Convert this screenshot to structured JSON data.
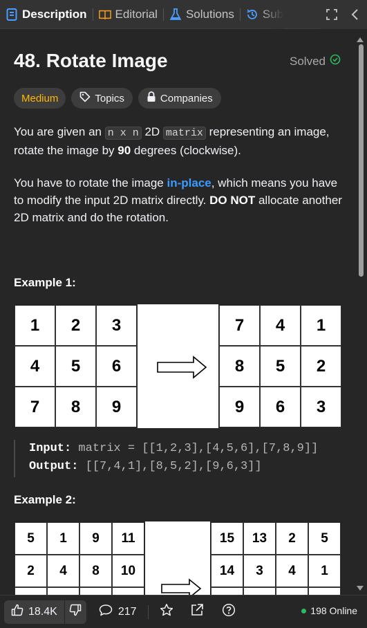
{
  "tabs": [
    {
      "label": "Description",
      "icon": "description-icon",
      "active": true
    },
    {
      "label": "Editorial",
      "icon": "book-icon",
      "active": false
    },
    {
      "label": "Solutions",
      "icon": "flask-icon",
      "active": false
    },
    {
      "label": "Subm",
      "icon": "history-icon",
      "active": false
    }
  ],
  "toolbar_icons": [
    "expand-icon",
    "chevron-left-icon"
  ],
  "problem": {
    "title": "48. Rotate Image",
    "status": "Solved",
    "difficulty": "Medium",
    "topics_label": "Topics",
    "companies_label": "Companies",
    "p1_a": "You are given an ",
    "p1_code1": "n x n",
    "p1_b": " 2D ",
    "p1_code2": "matrix",
    "p1_c": " representing an image, rotate the image by ",
    "p1_bold": "90",
    "p1_d": " degrees (clockwise).",
    "p2_a": "You have to rotate the image ",
    "p2_link": "in-place",
    "p2_b": ", which means you have to modify the input 2D matrix directly. ",
    "p2_bold": "DO NOT",
    "p2_c": " allocate another 2D matrix and do the rotation."
  },
  "example1": {
    "heading": "Example 1:",
    "input_grid": [
      "1",
      "2",
      "3",
      "4",
      "5",
      "6",
      "7",
      "8",
      "9"
    ],
    "output_grid": [
      "7",
      "4",
      "1",
      "8",
      "5",
      "2",
      "9",
      "6",
      "3"
    ],
    "input_label": "Input:",
    "input_value": " matrix = [[1,2,3],[4,5,6],[7,8,9]]",
    "output_label": "Output:",
    "output_value": " [[7,4,1],[8,5,2],[9,6,3]]"
  },
  "example2": {
    "heading": "Example 2:",
    "input_grid": [
      "5",
      "1",
      "9",
      "11",
      "2",
      "4",
      "8",
      "10",
      "",
      "",
      "",
      "",
      ""
    ],
    "output_grid": [
      "15",
      "13",
      "2",
      "5",
      "14",
      "3",
      "4",
      "1",
      "",
      "",
      "",
      ""
    ]
  },
  "bottom": {
    "likes": "18.4K",
    "comments": "217",
    "online": "198 Online"
  },
  "colors": {
    "accent_blue": "#3b9cff",
    "medium": "#ffb800",
    "solved_green": "#2cbb5d",
    "online_dot": "#2cbb5d"
  }
}
